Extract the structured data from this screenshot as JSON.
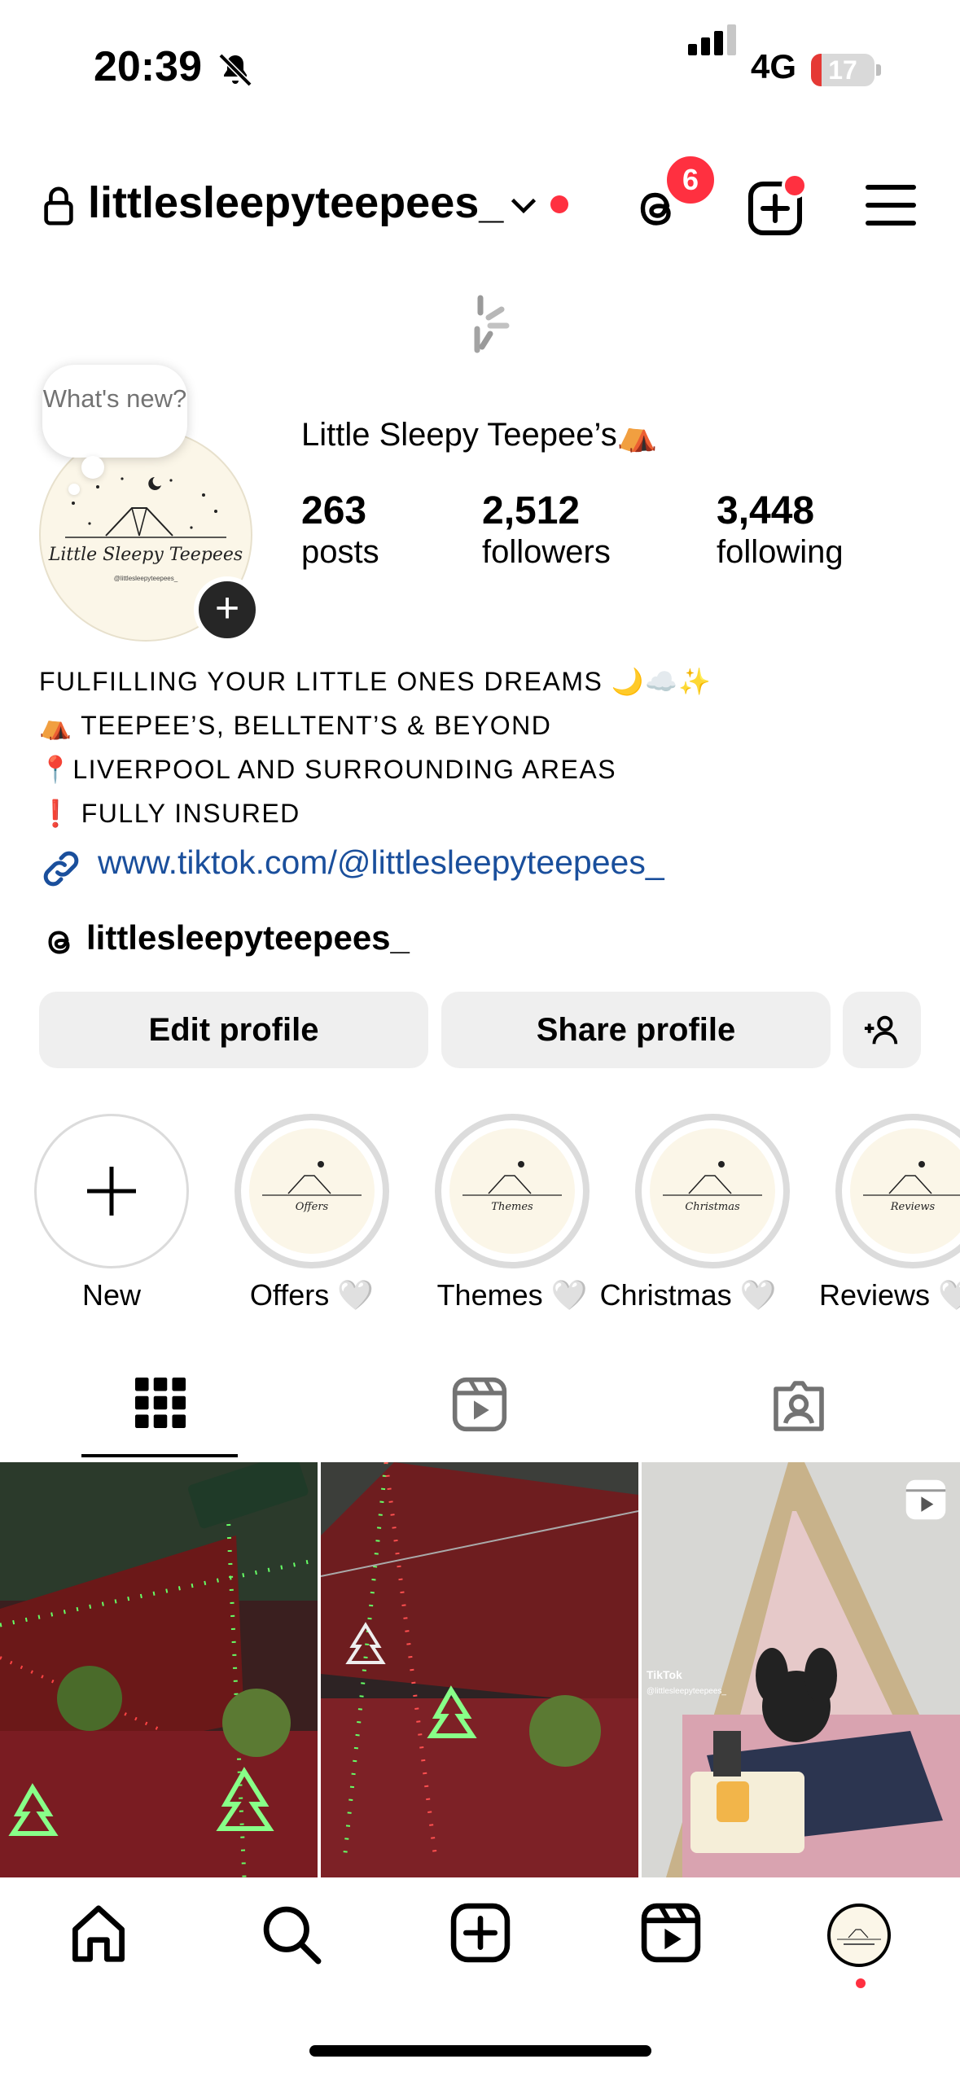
{
  "status": {
    "time": "20:39",
    "network": "4G",
    "battery": "17",
    "battery_level": 0.17,
    "battery_color": "#e53935"
  },
  "header": {
    "username": "littlesleepyteepees_",
    "threads_badge": "6"
  },
  "profile": {
    "note": "What's new?",
    "full_name": "Little Sleepy Teepee’s⛺",
    "avatar_text": "Little Sleepy Teepees",
    "avatar_handle": "@littlesleepyteepees_",
    "stats": [
      {
        "value": "263",
        "label": "posts"
      },
      {
        "value": "2,512",
        "label": "followers"
      },
      {
        "value": "3,448",
        "label": "following"
      }
    ],
    "bio": [
      "FULFILLING YOUR LITTLE ONES DREAMS 🌙☁️✨",
      "⛺ TEEPEE’S, BELLTENT’S & BEYOND",
      "📍LIVERPOOL AND SURROUNDING AREAS",
      "❗ FULLY INSURED"
    ],
    "link": "www.tiktok.com/@littlesleepyteepees_",
    "threads_handle": "littlesleepyteepees_"
  },
  "buttons": {
    "edit": "Edit profile",
    "share": "Share profile"
  },
  "highlights": [
    {
      "label": "New",
      "cover": ""
    },
    {
      "label": "Offers 🤍",
      "cover": "Offers"
    },
    {
      "label": "Themes 🤍",
      "cover": "Themes"
    },
    {
      "label": "Christmas 🤍",
      "cover": "Christmas"
    },
    {
      "label": "Reviews 🤍",
      "cover": "Reviews"
    }
  ],
  "grid": {
    "tiktok_label": "TikTok",
    "tiktok_handle": "@littlesleepyteepees_"
  },
  "colors": {
    "accent": "#ff3040",
    "link": "#1a4f9c",
    "button_bg": "#efefef"
  }
}
